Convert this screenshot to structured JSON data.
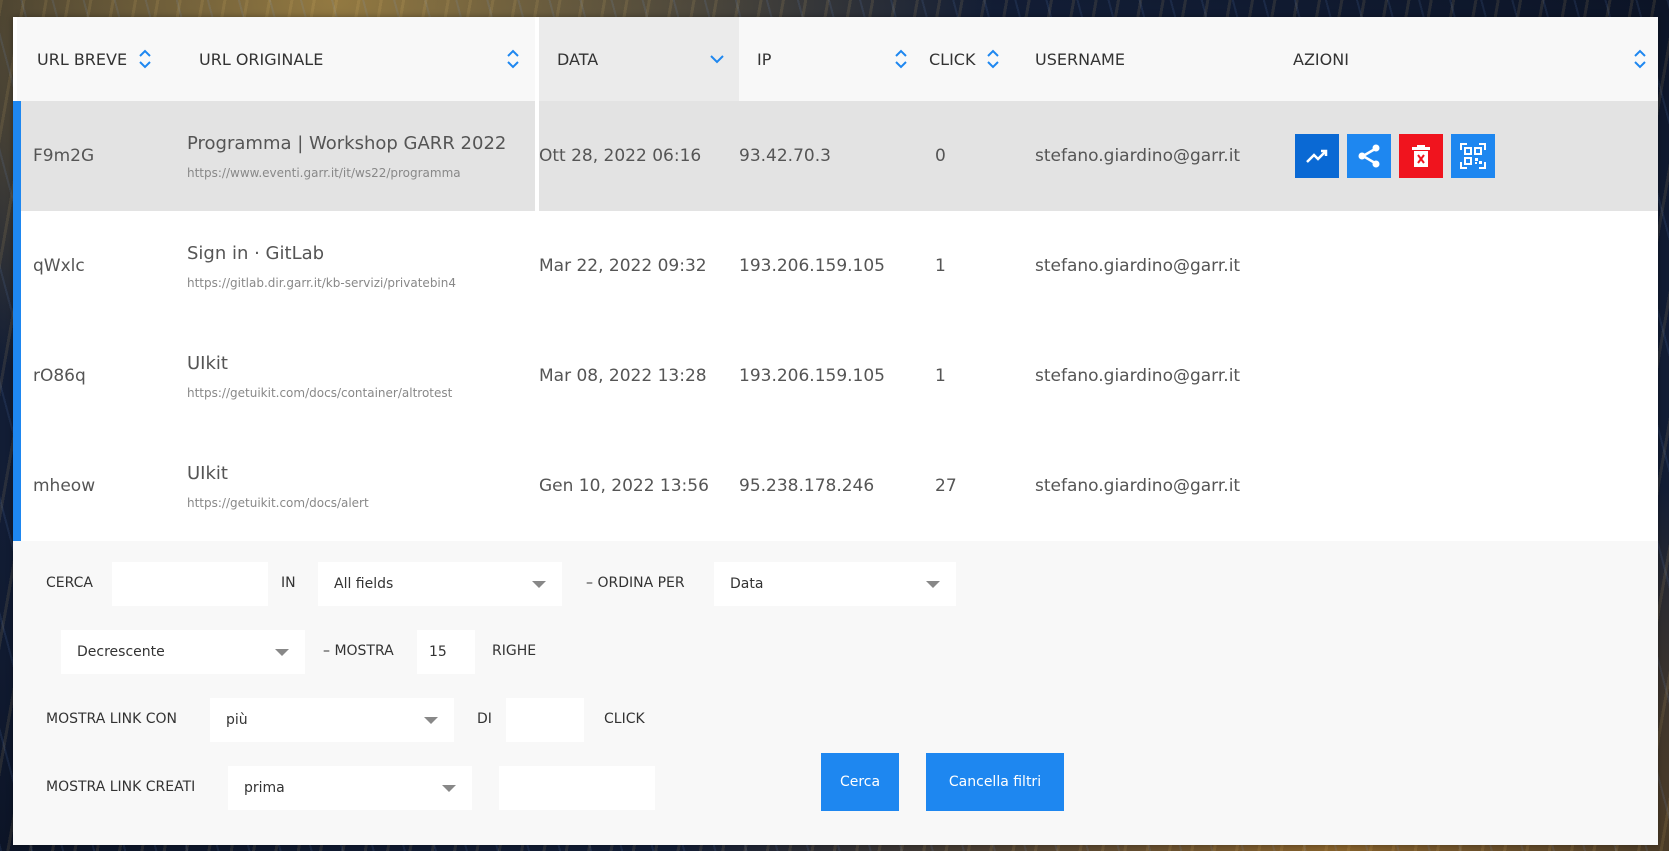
{
  "table": {
    "headers": {
      "short_url": "URL BREVE",
      "original_url": "URL ORIGINALE",
      "date": "DATA",
      "ip": "IP",
      "clicks": "CLICK",
      "username": "USERNAME",
      "actions": "AZIONI"
    },
    "rows": [
      {
        "short": "F9m2G",
        "title": "Programma | Workshop GARR 2022",
        "url": "https://www.eventi.garr.it/it/ws22/programma",
        "date": "Ott 28, 2022 06:16",
        "ip": "93.42.70.3",
        "clicks": "0",
        "username": "stefano.giardino@garr.it"
      },
      {
        "short": "qWxlc",
        "title": "Sign in · GitLab",
        "url": "https://gitlab.dir.garr.it/kb-servizi/privatebin4",
        "date": "Mar 22, 2022 09:32",
        "ip": "193.206.159.105",
        "clicks": "1",
        "username": "stefano.giardino@garr.it"
      },
      {
        "short": "rO86q",
        "title": "UIkit",
        "url": "https://getuikit.com/docs/container/altrotest",
        "date": "Mar 08, 2022 13:28",
        "ip": "193.206.159.105",
        "clicks": "1",
        "username": "stefano.giardino@garr.it"
      },
      {
        "short": "mheow",
        "title": "UIkit",
        "url": "https://getuikit.com/docs/alert",
        "date": "Gen 10, 2022 13:56",
        "ip": "95.238.178.246",
        "clicks": "27",
        "username": "stefano.giardino@garr.it"
      }
    ],
    "action_icons": [
      "stats-chart-icon",
      "share-icon",
      "delete-icon",
      "qr-code-icon"
    ]
  },
  "filters": {
    "search_label": "CERCA",
    "search_value": "",
    "in_label": "IN",
    "field_select": "All fields",
    "order_label": "– ORDINA PER",
    "order_select": "Data",
    "direction_select": "Decrescente",
    "show_label": "– MOSTRA",
    "rows_value": "15",
    "rows_label": "RIGHE",
    "show_links_with_label": "MOSTRA LINK CON",
    "compare_select": "più",
    "di_label": "DI",
    "clicks_value": "",
    "clicks_label": "CLICK",
    "created_label": "MOSTRA LINK CREATI",
    "created_select": "prima",
    "created_date_value": "",
    "search_button": "Cerca",
    "clear_button": "Cancella filtri"
  },
  "colors": {
    "accent": "#1e87f0",
    "danger": "#f0141e",
    "selected_row": "#e3e3e3"
  }
}
